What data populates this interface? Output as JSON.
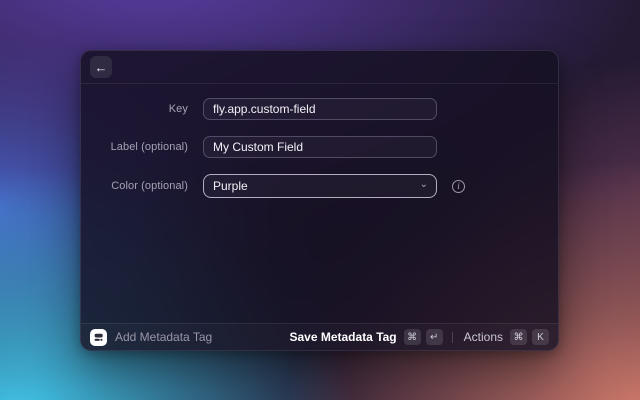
{
  "colors": {
    "bg-top-left": "#5a3fa8",
    "bg-mid-left": "#4767cc",
    "bg-bottom-left": "#41c6ea",
    "bg-bottom-right": "#d97f6d",
    "bg-top-right": "#241a33",
    "window-bg": "rgba(21,16,33,0.82)",
    "focus-border": "#b3aec4"
  },
  "window": {
    "header": {
      "back_icon": "←"
    },
    "form": {
      "fields": [
        {
          "label": "Key",
          "value": "fly.app.custom-field"
        },
        {
          "label": "Label (optional)",
          "value": "My Custom Field"
        },
        {
          "label": "Color (optional)",
          "value": "Purple",
          "chevron": "⌄",
          "info_glyph": "i"
        }
      ]
    },
    "footer": {
      "app_icon_name": "metadata-tag-extension-icon",
      "command_title": "Add Metadata Tag",
      "primary_action": {
        "label": "Save Metadata Tag",
        "keys": [
          "⌘",
          "↵"
        ]
      },
      "secondary_action": {
        "label": "Actions",
        "keys": [
          "⌘",
          "K"
        ]
      }
    }
  }
}
